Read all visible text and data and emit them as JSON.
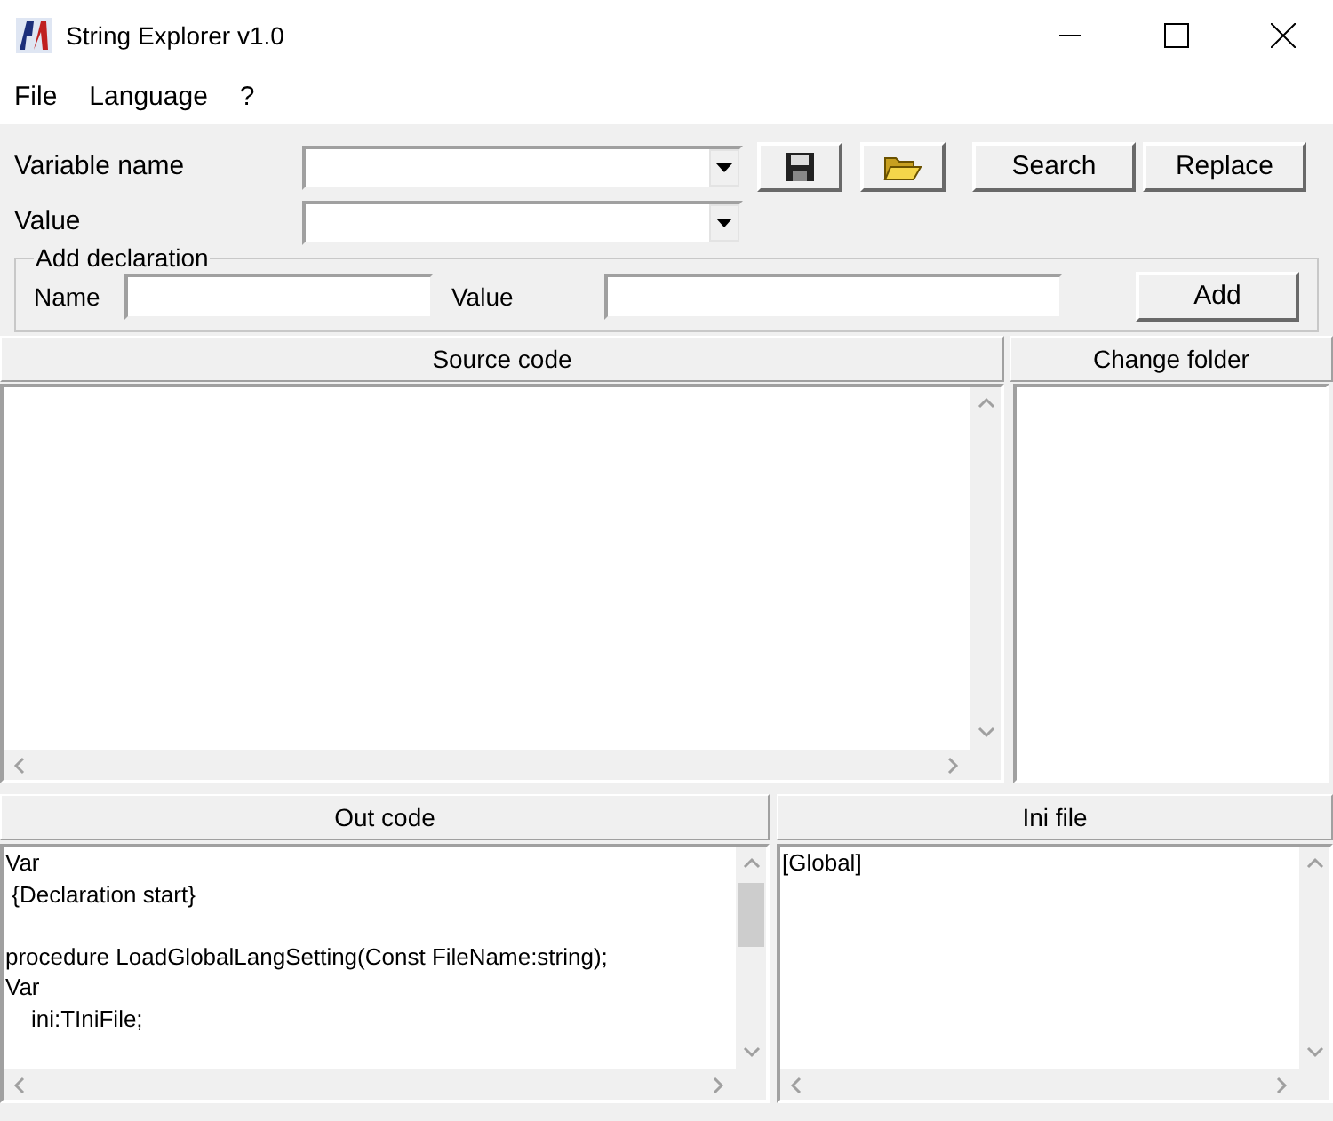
{
  "window": {
    "title": "String Explorer v1.0"
  },
  "menu": [
    "File",
    "Language",
    "?"
  ],
  "form": {
    "variable_label": "Variable name",
    "value_label": "Value",
    "search_button": "Search",
    "replace_button": "Replace"
  },
  "add_declaration": {
    "title": "Add declaration",
    "name_label": "Name",
    "value_label": "Value",
    "add_button": "Add"
  },
  "source_code": {
    "header": "Source code"
  },
  "change_folder": {
    "header": "Change folder"
  },
  "out_code": {
    "header": "Out code",
    "text": "Var\n {Declaration start}\n\nprocedure LoadGlobalLangSetting(Const FileName:string);\nVar\n    ini:TIniFile;"
  },
  "ini_file": {
    "header": "Ini file",
    "text": "[Global]"
  }
}
